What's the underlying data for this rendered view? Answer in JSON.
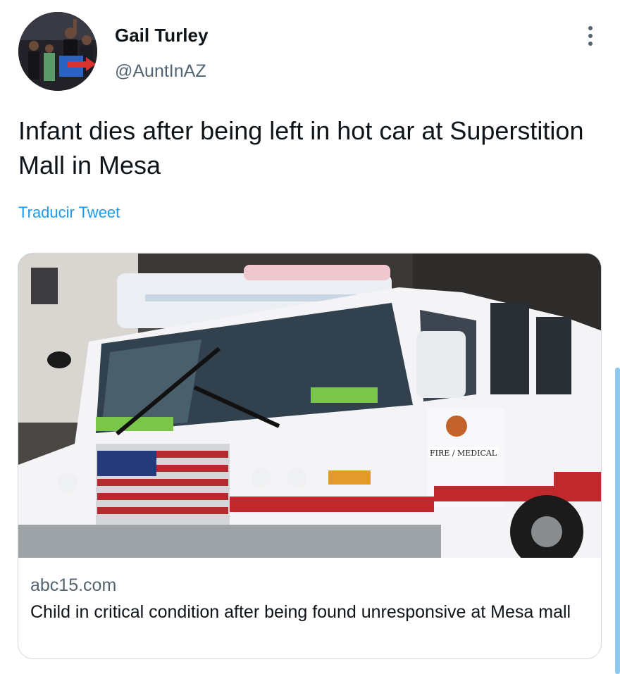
{
  "author": {
    "display_name": "Gail Turley",
    "handle": "@AuntInAZ"
  },
  "tweet": {
    "text": "Infant dies after being left in hot car at Superstition Mall in Mesa",
    "translate_label": "Traducir Tweet"
  },
  "card": {
    "domain": "abc15.com",
    "title": "Child in critical condition after being found unresponsive at Mesa mall",
    "image_alt_text": "FIRE / MEDICAL"
  },
  "icons": {
    "more": "more-vertical-icon"
  },
  "colors": {
    "link": "#1d9bf0",
    "secondary_text": "#536471",
    "border": "#cfd9de",
    "scrollbar": "#8ec9f0"
  }
}
